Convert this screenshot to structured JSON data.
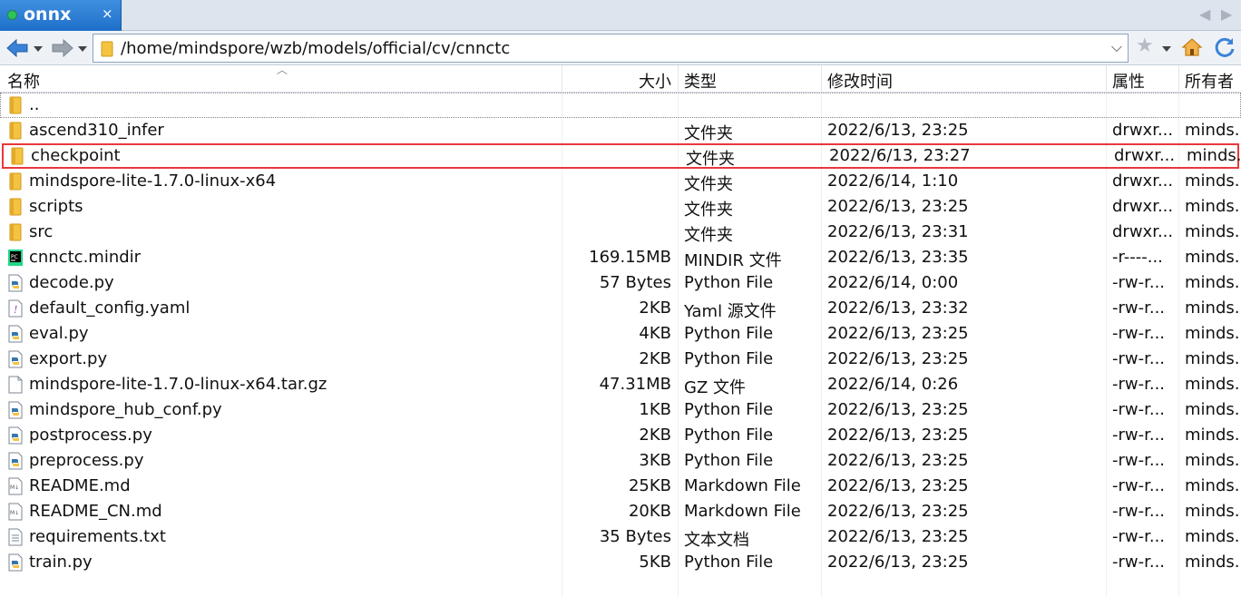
{
  "tab": {
    "title": "onnx",
    "close": "×"
  },
  "tab_nav": {
    "prev": "◀",
    "next": "▶"
  },
  "address": {
    "path": "/home/mindspore/wzb/models/official/cv/cnnctc",
    "chevron": "⌵"
  },
  "toolbar": {
    "star": "★"
  },
  "columns": {
    "name": "名称",
    "size": "大小",
    "type": "类型",
    "modified": "修改时间",
    "attributes": "属性",
    "owner": "所有者"
  },
  "rows": [
    {
      "name": "..",
      "size": "",
      "type": "",
      "modified": "",
      "attr": "",
      "owner": "",
      "icon": "folder-icon"
    },
    {
      "name": "ascend310_infer",
      "size": "",
      "type": "文件夹",
      "modified": "2022/6/13, 23:25",
      "attr": "drwxr...",
      "owner": "minds...",
      "icon": "folder-icon"
    },
    {
      "name": "checkpoint",
      "size": "",
      "type": "文件夹",
      "modified": "2022/6/13, 23:27",
      "attr": "drwxr...",
      "owner": "minds...",
      "icon": "folder-icon"
    },
    {
      "name": "mindspore-lite-1.7.0-linux-x64",
      "size": "",
      "type": "文件夹",
      "modified": "2022/6/14, 1:10",
      "attr": "drwxr...",
      "owner": "minds...",
      "icon": "folder-icon"
    },
    {
      "name": "scripts",
      "size": "",
      "type": "文件夹",
      "modified": "2022/6/13, 23:25",
      "attr": "drwxr...",
      "owner": "minds...",
      "icon": "folder-icon"
    },
    {
      "name": "src",
      "size": "",
      "type": "文件夹",
      "modified": "2022/6/13, 23:31",
      "attr": "drwxr...",
      "owner": "minds...",
      "icon": "folder-icon"
    },
    {
      "name": "cnnctc.mindir",
      "size": "169.15MB",
      "type": "MINDIR 文件",
      "modified": "2022/6/13, 23:35",
      "attr": "-r----...",
      "owner": "minds...",
      "icon": "pycharm-file-icon"
    },
    {
      "name": "decode.py",
      "size": "57 Bytes",
      "type": "Python File",
      "modified": "2022/6/14, 0:00",
      "attr": "-rw-r...",
      "owner": "minds...",
      "icon": "python-file-icon"
    },
    {
      "name": "default_config.yaml",
      "size": "2KB",
      "type": "Yaml 源文件",
      "modified": "2022/6/13, 23:32",
      "attr": "-rw-r...",
      "owner": "minds...",
      "icon": "yaml-file-icon"
    },
    {
      "name": "eval.py",
      "size": "4KB",
      "type": "Python File",
      "modified": "2022/6/13, 23:25",
      "attr": "-rw-r...",
      "owner": "minds...",
      "icon": "python-file-icon"
    },
    {
      "name": "export.py",
      "size": "2KB",
      "type": "Python File",
      "modified": "2022/6/13, 23:25",
      "attr": "-rw-r...",
      "owner": "minds...",
      "icon": "python-file-icon"
    },
    {
      "name": "mindspore-lite-1.7.0-linux-x64.tar.gz",
      "size": "47.31MB",
      "type": "GZ 文件",
      "modified": "2022/6/14, 0:26",
      "attr": "-rw-r...",
      "owner": "minds...",
      "icon": "blank-file-icon"
    },
    {
      "name": "mindspore_hub_conf.py",
      "size": "1KB",
      "type": "Python File",
      "modified": "2022/6/13, 23:25",
      "attr": "-rw-r...",
      "owner": "minds...",
      "icon": "python-file-icon"
    },
    {
      "name": "postprocess.py",
      "size": "2KB",
      "type": "Python File",
      "modified": "2022/6/13, 23:25",
      "attr": "-rw-r...",
      "owner": "minds...",
      "icon": "python-file-icon"
    },
    {
      "name": "preprocess.py",
      "size": "3KB",
      "type": "Python File",
      "modified": "2022/6/13, 23:25",
      "attr": "-rw-r...",
      "owner": "minds...",
      "icon": "python-file-icon"
    },
    {
      "name": "README.md",
      "size": "25KB",
      "type": "Markdown File",
      "modified": "2022/6/13, 23:25",
      "attr": "-rw-r...",
      "owner": "minds...",
      "icon": "markdown-file-icon"
    },
    {
      "name": "README_CN.md",
      "size": "20KB",
      "type": "Markdown File",
      "modified": "2022/6/13, 23:25",
      "attr": "-rw-r...",
      "owner": "minds...",
      "icon": "markdown-file-icon"
    },
    {
      "name": "requirements.txt",
      "size": "35 Bytes",
      "type": "文本文档",
      "modified": "2022/6/13, 23:25",
      "attr": "-rw-r...",
      "owner": "minds...",
      "icon": "text-file-icon"
    },
    {
      "name": "train.py",
      "size": "5KB",
      "type": "Python File",
      "modified": "2022/6/13, 23:25",
      "attr": "-rw-r...",
      "owner": "minds...",
      "icon": "python-file-icon"
    }
  ],
  "colors": {
    "tab_accent": "#1e6fc9",
    "selection_outline": "#e8383d",
    "folder": "#f5c342"
  }
}
